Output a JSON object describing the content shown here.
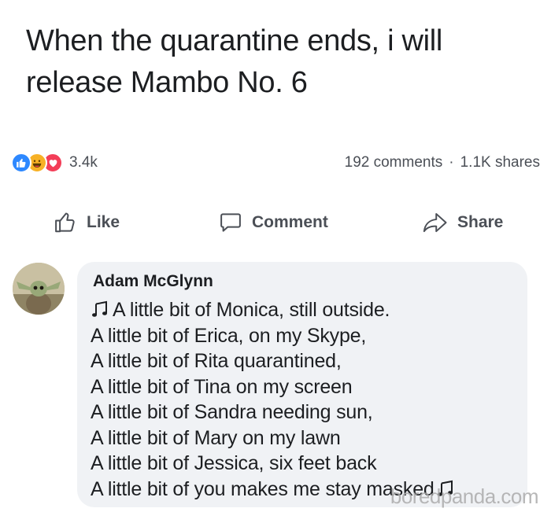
{
  "post": {
    "lines": [
      "When the quarantine ends, i will",
      "release Mambo No. 6"
    ]
  },
  "stats": {
    "reactions": [
      "like",
      "haha",
      "love"
    ],
    "reaction_count": "3.4k",
    "comments": "192 comments",
    "separator": "·",
    "shares": "1.1K shares"
  },
  "actions": {
    "like": "Like",
    "comment": "Comment",
    "share": "Share"
  },
  "comment": {
    "author": "Adam McGlynn",
    "lines": [
      "A little bit of Monica, still outside.",
      "A little bit of Erica, on my Skype,",
      "A little bit of Rita quarantined,",
      "A little bit of Tina on my screen",
      "A little bit of Sandra needing sun,",
      "A little bit of Mary on my lawn",
      "A little bit of Jessica, six feet back",
      "A little bit of you makes me stay masked"
    ]
  },
  "watermark": "boredpanda.com",
  "colors": {
    "like_blue": "#2d88ff",
    "haha_yellow": "#f7b125",
    "love_red": "#f33e58",
    "bubble_bg": "#f0f2f5",
    "meta_text": "#4b4f56"
  }
}
